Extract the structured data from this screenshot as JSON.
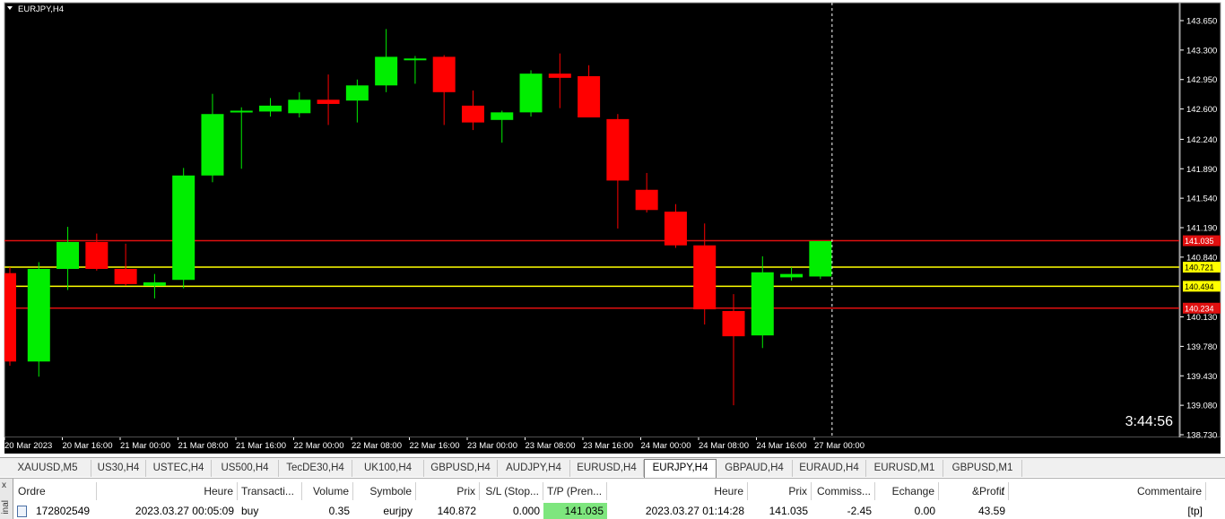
{
  "chart": {
    "title": "EURJPY,H4",
    "countdown": "3:44:56",
    "price_scale": [
      "143.650",
      "143.300",
      "142.950",
      "142.600",
      "142.240",
      "141.890",
      "141.540",
      "141.190",
      "140.840",
      "140.130",
      "139.780",
      "139.430",
      "139.080",
      "138.730"
    ],
    "time_scale": [
      "20 Mar 2023",
      "20 Mar 16:00",
      "21 Mar 00:00",
      "21 Mar 08:00",
      "21 Mar 16:00",
      "22 Mar 00:00",
      "22 Mar 08:00",
      "22 Mar 16:00",
      "23 Mar 00:00",
      "23 Mar 08:00",
      "23 Mar 16:00",
      "24 Mar 00:00",
      "24 Mar 08:00",
      "24 Mar 16:00",
      "27 Mar 00:00"
    ],
    "price_range": [
      138.73,
      143.65
    ],
    "levels": [
      {
        "price": 141.035,
        "label": "141.035",
        "color": "#e01010"
      },
      {
        "price": 140.721,
        "label": "140.721",
        "color": "#ffff00"
      },
      {
        "price": 140.494,
        "label": "140.494",
        "color": "#ffff00"
      },
      {
        "price": 140.234,
        "label": "140.234",
        "color": "#e01010"
      }
    ],
    "colors": {
      "bull": "#00ee00",
      "bear": "#ff0000",
      "background": "#000000",
      "text": "#ffffff"
    },
    "candles": [
      [
        140.65,
        140.72,
        139.55,
        139.6
      ],
      [
        139.6,
        140.78,
        139.42,
        140.7
      ],
      [
        140.7,
        141.2,
        140.45,
        141.02
      ],
      [
        141.02,
        141.12,
        140.68,
        140.7
      ],
      [
        140.7,
        141.0,
        140.5,
        140.52
      ],
      [
        140.5,
        140.64,
        140.35,
        140.54
      ],
      [
        140.57,
        141.9,
        140.47,
        141.81
      ],
      [
        141.81,
        142.78,
        141.73,
        142.54
      ],
      [
        142.56,
        142.62,
        141.89,
        142.58
      ],
      [
        142.57,
        142.73,
        142.51,
        142.64
      ],
      [
        142.55,
        142.8,
        142.5,
        142.71
      ],
      [
        142.71,
        143.01,
        142.41,
        142.66
      ],
      [
        142.7,
        142.95,
        142.44,
        142.88
      ],
      [
        142.88,
        143.55,
        142.8,
        143.22
      ],
      [
        143.2,
        143.23,
        142.9,
        143.2
      ],
      [
        143.22,
        143.24,
        142.41,
        142.8
      ],
      [
        142.64,
        142.82,
        142.35,
        142.44
      ],
      [
        142.47,
        142.58,
        142.2,
        142.56
      ],
      [
        142.56,
        143.06,
        142.51,
        143.02
      ],
      [
        143.02,
        143.26,
        142.61,
        142.97
      ],
      [
        142.99,
        143.12,
        142.51,
        142.5
      ],
      [
        142.48,
        142.54,
        141.18,
        141.75
      ],
      [
        141.64,
        141.84,
        141.37,
        141.4
      ],
      [
        141.38,
        141.47,
        140.95,
        140.98
      ],
      [
        140.98,
        141.24,
        140.04,
        140.22
      ],
      [
        140.2,
        140.4,
        139.08,
        139.9
      ],
      [
        139.91,
        140.85,
        139.76,
        140.66
      ],
      [
        140.6,
        140.72,
        140.56,
        140.64
      ],
      [
        140.61,
        141.03,
        140.58,
        141.03
      ]
    ]
  },
  "tabs": [
    "XAUUSD,M5",
    "US30,H4",
    "USTEC,H4",
    "US500,H4",
    "TecDE30,H4",
    "UK100,H4",
    "GBPUSD,H4",
    "AUDJPY,H4",
    "EURUSD,H4",
    "EURJPY,H4",
    "GBPAUD,H4",
    "EURAUD,H4",
    "EURUSD,M1",
    "GBPUSD,M1"
  ],
  "active_tab": "EURJPY,H4",
  "terminal": {
    "side_label": "inal",
    "side_close": "x",
    "columns": [
      "Ordre",
      "Heure",
      "Transacti...",
      "Volume",
      "Symbole",
      "Prix",
      "S/L (Stop...",
      "T/P (Pren...",
      "Heure",
      "Prix",
      "Commiss...",
      "Echange",
      "&Profit",
      "/",
      "Commentaire"
    ],
    "row": {
      "order": "172802549",
      "open_time": "2023.03.27 00:05:09",
      "type": "buy",
      "volume": "0.35",
      "symbol": "eurjpy",
      "price": "140.872",
      "sl": "0.000",
      "tp": "141.035",
      "close_time": "2023.03.27 01:14:28",
      "close_price": "141.035",
      "commission": "-2.45",
      "swap": "0.00",
      "profit": "43.59",
      "comment": "[tp]"
    }
  }
}
